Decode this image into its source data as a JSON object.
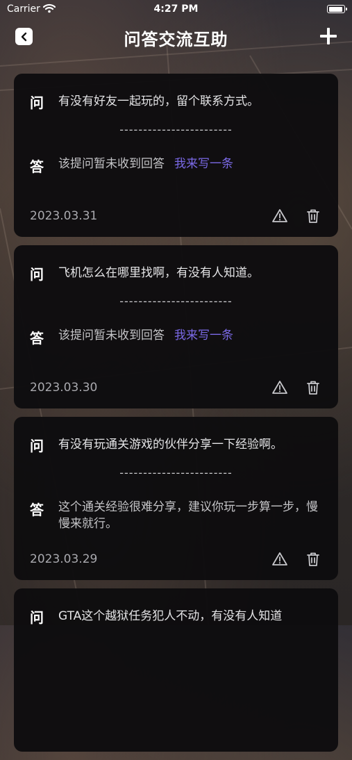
{
  "status_bar": {
    "carrier": "Carrier",
    "time": "4:27 PM"
  },
  "nav": {
    "title": "问答交流互助",
    "back_icon": "chevron-left-icon",
    "add_icon": "plus-icon"
  },
  "labels": {
    "question_mark": "问",
    "answer_mark": "答",
    "divider": "------------------------"
  },
  "cards": [
    {
      "question": "有没有好友一起玩的，留个联系方式。",
      "answer": "该提问暂未收到回答",
      "answer_link": "我来写一条",
      "date": "2023.03.31"
    },
    {
      "question": "飞机怎么在哪里找啊，有没有人知道。",
      "answer": "该提问暂未收到回答",
      "answer_link": "我来写一条",
      "date": "2023.03.30"
    },
    {
      "question": "有没有玩通关游戏的伙伴分享一下经验啊。",
      "answer": "这个通关经验很难分享，建议你玩一步算一步，慢慢来就行。",
      "answer_link": "",
      "date": "2023.03.29"
    },
    {
      "question": "GTA这个越狱任务犯人不动，有没有人知道",
      "answer": "",
      "answer_link": "",
      "date": ""
    }
  ],
  "colors": {
    "link": "#7a69e6",
    "card_bg": "#0e0d0f"
  }
}
